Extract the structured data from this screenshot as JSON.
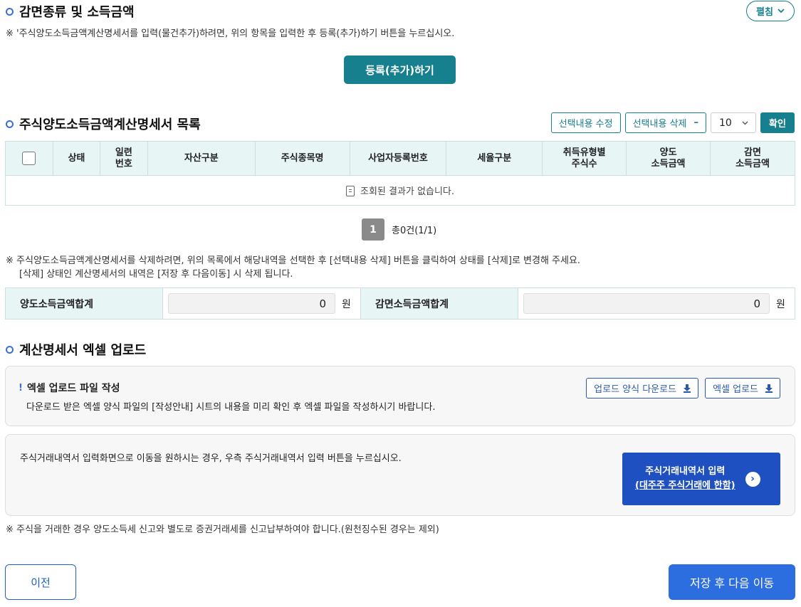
{
  "section1": {
    "title": "감면종류 및 소득금액",
    "toggle_label": "펼침",
    "note": "※ '주식양도소득금액계산명세서를 입력(물건추가)하려면, 위의 항목을 입력한 후 등록(추가)하기 버튼을 누르십시오.",
    "register_label": "등록(추가)하기"
  },
  "section2": {
    "title": "주식양도소득금액계산명세서 목록",
    "edit_label": "선택내용 수정",
    "delete_label": "선택내용 삭제",
    "delete_icon": "minus-icon",
    "page_size": "10",
    "confirm_label": "확인",
    "columns": [
      "상태",
      "일련\n번호",
      "자산구분",
      "주식종목명",
      "사업자등록번호",
      "세율구분",
      "취득유형별\n주식수",
      "양도\n소득금액",
      "감면\n소득금액"
    ],
    "empty_message": "조회된 결과가 없습니다.",
    "pagination": {
      "current": "1",
      "total": "총0건(1/1)"
    },
    "notes": [
      "※ 주식양도소득금액계산명세서를 삭제하려면, 위의 목록에서 해당내역을 선택한 후 [선택내용 삭제] 버튼을 클릭하여 상태를 [삭제]로 변경해 주세요.",
      "[삭제] 상태인 계산명세서의 내역은 [저장 후 다음이동] 시 삭제 됩니다."
    ],
    "sum": {
      "transfer_label": "양도소득금액합계",
      "transfer_value": "0",
      "reduction_label": "감면소득금액합계",
      "reduction_value": "0",
      "unit": "원"
    }
  },
  "section3": {
    "title": "계산명세서 엑셀 업로드",
    "panel_title": "엑셀 업로드 파일 작성",
    "panel_mark": "!",
    "panel_desc": "다운로드 받은 엑셀 양식 파일의 [작성안내] 시트의 내용을 미리 확인 후 엑셀 파일을 작성하시기 바랍니다.",
    "download_label": "업로드 양식 다운로드",
    "upload_label": "엑셀 업로드",
    "stock_desc": "주식거래내역서 입력화면으로 이동을 원하시는 경우, 우측 주식거래내역서 입력 버튼을 누르십시오.",
    "stock_btn_line1": "주식거래내역서 입력",
    "stock_btn_line2": "(대주주 주식거래에 한함)",
    "bottom_note": "※ 주식을 거래한 경우 양도소득세 신고와 별도로 증권거래세를 신고납부하여야 합니다.(원천징수된 경우는 제외)"
  },
  "footer": {
    "prev_label": "이전",
    "next_label": "저장 후 다음 이동"
  },
  "colors": {
    "teal": "#17808f",
    "blue": "#1f50c2",
    "accent": "#3b6fd8"
  }
}
